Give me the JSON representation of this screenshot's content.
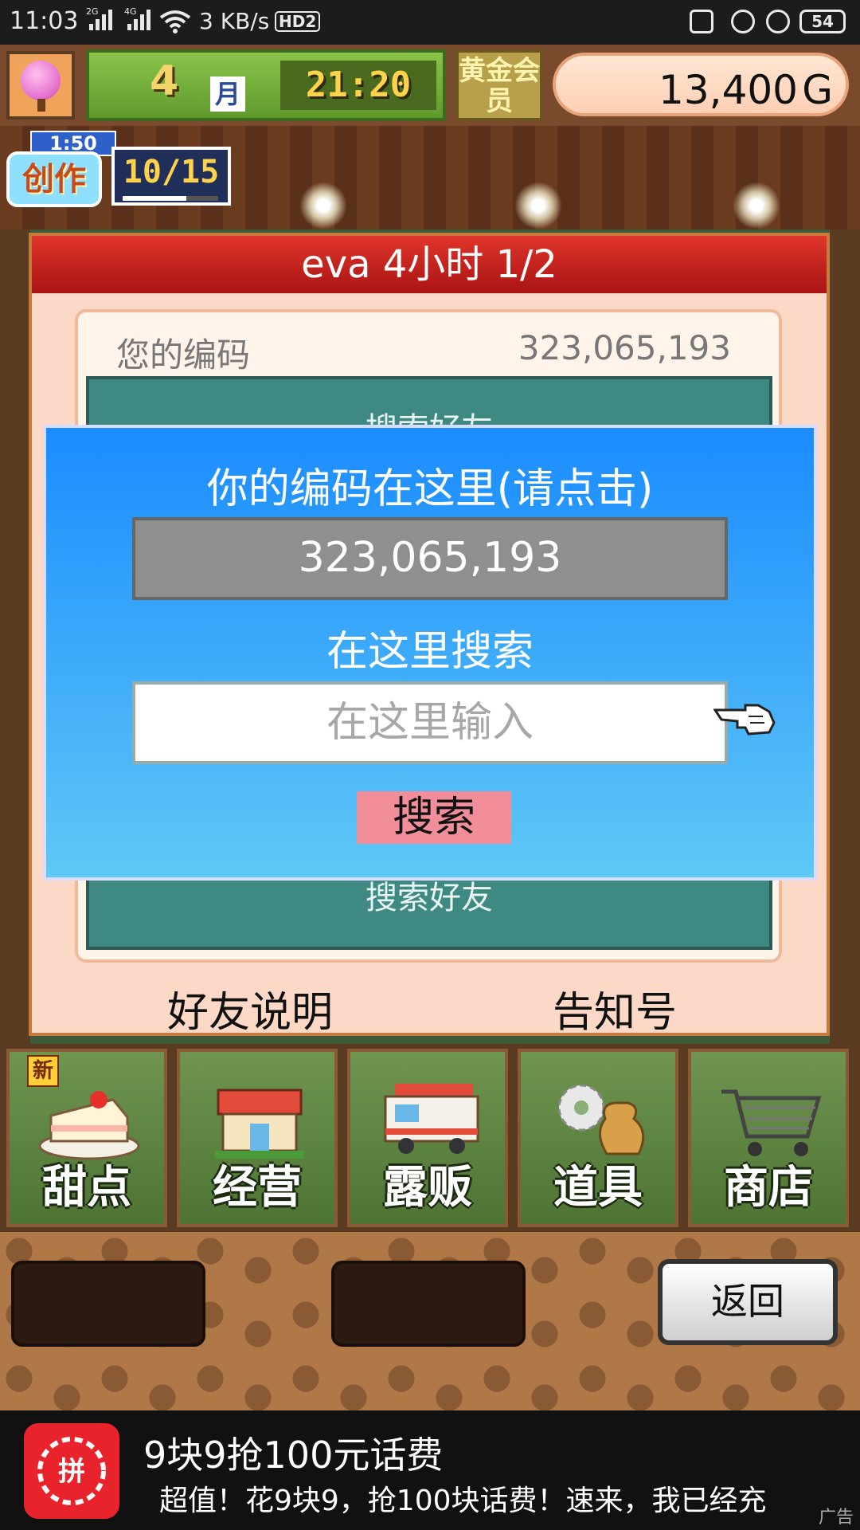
{
  "status_bar": {
    "time": "11:03",
    "network1": "2G",
    "network2": "4G",
    "speed": "3 KB/s",
    "hd": "HD2",
    "battery": "54"
  },
  "hud": {
    "month_number": "4",
    "month_unit": "月",
    "clock": "21:20",
    "gold_member": "黄金会员",
    "money_value": "13,400",
    "money_unit": "G"
  },
  "craft": {
    "timer": "1:50",
    "label": "创作",
    "count": "10/15",
    "progress": 0.67
  },
  "dialog": {
    "title": "eva  4小时 1/2",
    "code_label": "您的编码",
    "code_value": "323,065,193",
    "teal_top_text": "搜索好友",
    "teal_bottom_text": "搜索好友",
    "footer_left": "好友说明",
    "footer_right": "告知号"
  },
  "popup": {
    "heading": "你的编码在这里(请点击)",
    "code_value": "323,065,193",
    "search_heading": "在这里搜索",
    "search_placeholder": "在这里输入",
    "search_button": "搜索"
  },
  "menu": {
    "new_badge": "新",
    "items": [
      "甜点",
      "经营",
      "露贩",
      "道具",
      "商店"
    ]
  },
  "bottom": {
    "return_label": "返回"
  },
  "ad": {
    "logo_text": "拼",
    "title": "9块9抢100元话费",
    "desc": "超值！花9块9，抢100块话费！速来，我已经充",
    "mark": "广告"
  }
}
